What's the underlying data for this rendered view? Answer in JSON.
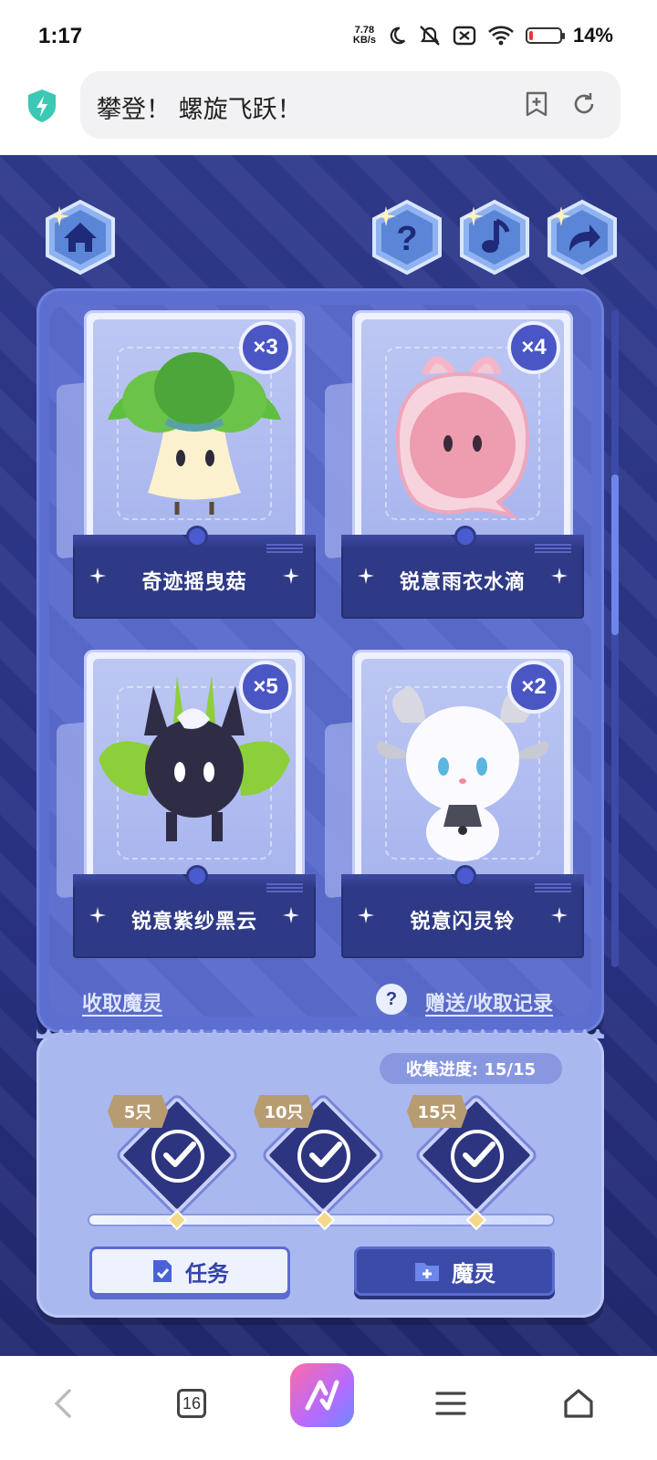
{
  "status": {
    "time": "1:17",
    "net_speed_value": "7.78",
    "net_speed_unit": "KB/s",
    "battery_text": "14%",
    "battery_level": 0.14,
    "battery_color": "#e53935"
  },
  "browser": {
    "title": "攀登！ 螺旋飞跃！",
    "tab_count": "16"
  },
  "game": {
    "top_buttons": [
      "home-icon",
      "help-icon",
      "music-icon",
      "share-icon"
    ],
    "cards": [
      {
        "name": "奇迹摇曳菇",
        "count": "×3"
      },
      {
        "name": "锐意雨衣水滴",
        "count": "×4"
      },
      {
        "name": "锐意紫纱黑云",
        "count": "×5"
      },
      {
        "name": "锐意闪灵铃",
        "count": "×2"
      }
    ],
    "links": {
      "collect": "收取魔灵",
      "history": "赠送/收取记录",
      "help": "?"
    },
    "progress": {
      "label": "收集进度: 15/15",
      "fraction": 1.0,
      "milestones": [
        {
          "tag": "5只",
          "done": true
        },
        {
          "tag": "10只",
          "done": true
        },
        {
          "tag": "15只",
          "done": true
        }
      ]
    },
    "buttons": {
      "task": "任务",
      "spirit": "魔灵"
    },
    "colors": {
      "background": "#27307a",
      "panel": "#5c6ed0",
      "accent": "#3c4aa8"
    }
  }
}
